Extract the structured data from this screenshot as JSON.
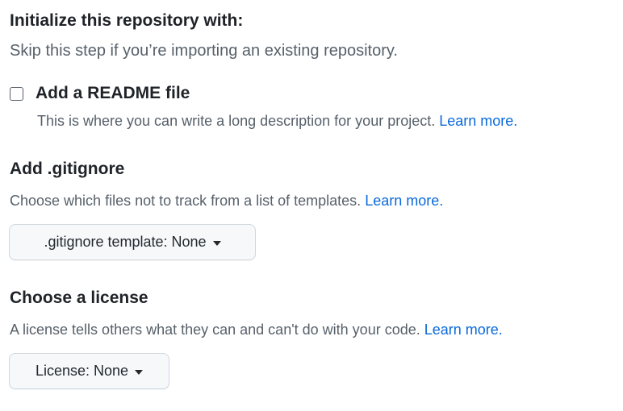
{
  "initialize": {
    "heading": "Initialize this repository with:",
    "subtext": "Skip this step if you’re importing an existing repository."
  },
  "readme": {
    "checked": false,
    "label": "Add a README file",
    "description": "This is where you can write a long description for your project.",
    "link": "Learn more."
  },
  "gitignore": {
    "title": "Add .gitignore",
    "description": "Choose which files not to track from a list of templates.",
    "link": "Learn more.",
    "dropdown_label": ".gitignore template: None"
  },
  "license": {
    "title": "Choose a license",
    "description": "A license tells others what they can and can't do with your code.",
    "link": "Learn more.",
    "dropdown_label": "License: None"
  },
  "colors": {
    "link": "#0969da",
    "muted_text": "#57606a",
    "button_bg": "#f6f8fa",
    "border": "#d0d7de"
  }
}
